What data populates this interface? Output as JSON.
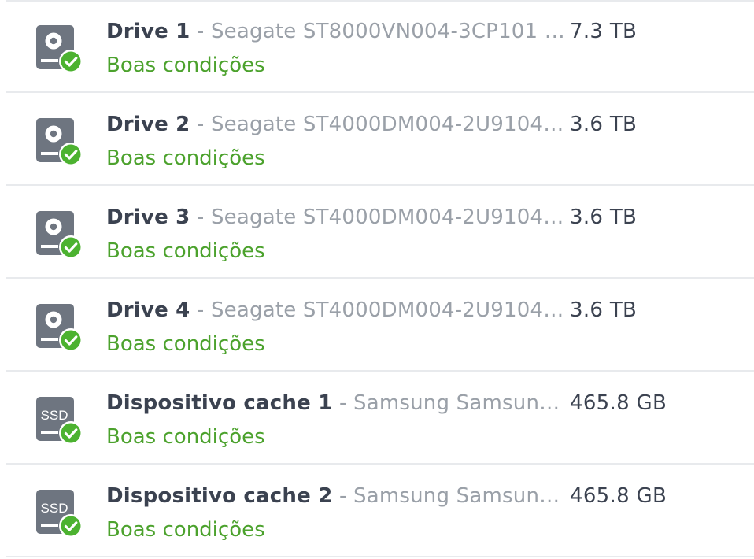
{
  "devices": [
    {
      "name": "Drive 1",
      "model": "Seagate ST8000VN004-3CP101 …",
      "capacity": "7.3 TB",
      "status": "Boas condições",
      "icon": "hdd-icon"
    },
    {
      "name": "Drive 2",
      "model": "Seagate ST4000DM004-2U9104…",
      "capacity": "3.6 TB",
      "status": "Boas condições",
      "icon": "hdd-icon"
    },
    {
      "name": "Drive 3",
      "model": "Seagate ST4000DM004-2U9104…",
      "capacity": "3.6 TB",
      "status": "Boas condições",
      "icon": "hdd-icon"
    },
    {
      "name": "Drive 4",
      "model": "Seagate ST4000DM004-2U9104…",
      "capacity": "3.6 TB",
      "status": "Boas condições",
      "icon": "hdd-icon"
    },
    {
      "name": "Dispositivo cache 1",
      "model": "Samsung Samsun…",
      "capacity": "465.8 GB",
      "status": "Boas condições",
      "icon": "ssd-icon",
      "icon_text": "SSD"
    },
    {
      "name": "Dispositivo cache 2",
      "model": "Samsung Samsun…",
      "capacity": "465.8 GB",
      "status": "Boas condições",
      "icon": "ssd-icon",
      "icon_text": "SSD"
    }
  ],
  "separator": " - ",
  "colors": {
    "name": "#3b4250",
    "model": "#9aa0a8",
    "status_ok": "#4ca22d",
    "badge_ok": "#4cb230",
    "icon_body": "#6e7580",
    "divider": "#e8eaed"
  }
}
